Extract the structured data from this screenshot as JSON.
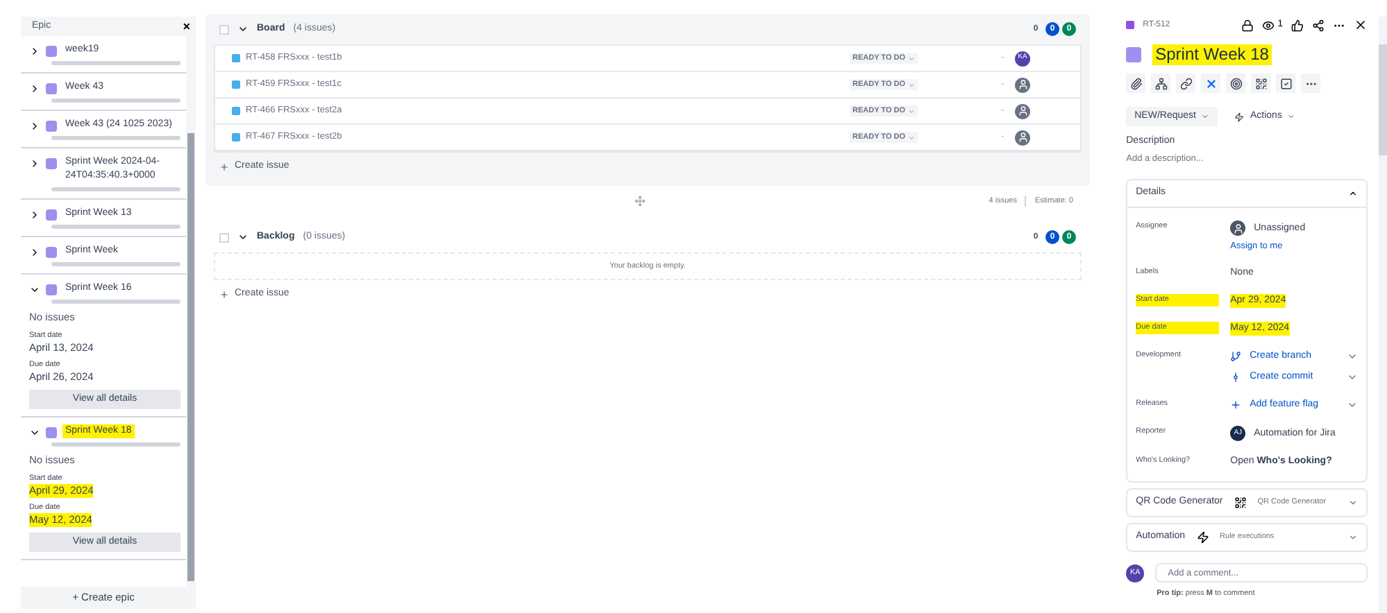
{
  "epic_panel": {
    "title": "Epic",
    "close": "×",
    "epics": [
      {
        "name": "week19",
        "expanded": false,
        "highlighted": false,
        "level": 0
      },
      {
        "name": "Week 43",
        "expanded": false,
        "highlighted": false,
        "level": 0
      },
      {
        "name": "Week 43 (24 1025 2023)",
        "expanded": false,
        "highlighted": false,
        "level": 0
      },
      {
        "name": "Sprint Week 2024-04-24T04:35:40.3+0000",
        "expanded": false,
        "highlighted": false,
        "level": 0
      },
      {
        "name": "Sprint Week 13",
        "expanded": false,
        "highlighted": false,
        "level": 0
      },
      {
        "name": "Sprint Week",
        "expanded": false,
        "highlighted": false,
        "level": 0
      },
      {
        "name": "Sprint Week 16",
        "expanded": true,
        "highlighted": false,
        "level": 0,
        "summary": "No issues",
        "start_label": "Start date",
        "start_date": "April 13, 2024",
        "start_highlighted": false,
        "due_label": "Due date",
        "due_date": "April 26, 2024",
        "due_highlighted": false,
        "button": "View all details"
      },
      {
        "name": "Sprint Week 18",
        "expanded": true,
        "highlighted": true,
        "level": 0,
        "summary": "No issues",
        "start_label": "Start date",
        "start_date": "April 29, 2024",
        "start_highlighted": true,
        "due_label": "Due date",
        "due_date": "May 12, 2024",
        "due_highlighted": true,
        "button": "View all details"
      }
    ],
    "create_button": "+ Create epic"
  },
  "sprints": [
    {
      "name": "Board",
      "checked": false,
      "count": "(4 issues)",
      "counters": [
        "0",
        "0",
        "0"
      ],
      "issues": [
        {
          "key": "RT-458",
          "summary": "FRSxxx - test1b",
          "status": "READY TO DO",
          "estimate": "-",
          "assignee": {
            "kind": "avatar",
            "initials": "KA"
          }
        },
        {
          "key": "RT-459",
          "summary": "FRSxxx - test1c",
          "status": "READY TO DO",
          "estimate": "-",
          "assignee": {
            "kind": "unassigned"
          }
        },
        {
          "key": "RT-466",
          "summary": "FRSxxx - test2a",
          "status": "READY TO DO",
          "estimate": "-",
          "assignee": {
            "kind": "unassigned"
          }
        },
        {
          "key": "RT-467",
          "summary": "FRSxxx - test2b",
          "status": "READY TO DO",
          "estimate": "-",
          "assignee": {
            "kind": "unassigned"
          }
        }
      ],
      "create": "Create issue",
      "footer": {
        "issues": "4 issues",
        "estimate": "Estimate: 0"
      }
    },
    {
      "name": "Backlog",
      "checked": false,
      "count": "(0 issues)",
      "counters": [
        "0",
        "0",
        "0"
      ],
      "empty": "Your backlog is empty.",
      "create": "Create issue"
    }
  ],
  "detail": {
    "key": "RT-512",
    "watchers": "1",
    "title": "Sprint Week 18",
    "title_highlighted": true,
    "status": "NEW/Request",
    "actions": "Actions",
    "description_label": "Description",
    "description_placeholder": "Add a description...",
    "details": {
      "title": "Details",
      "expanded": true,
      "fields": [
        {
          "label": "Assignee",
          "kind": "user",
          "value": "Unassigned",
          "link": "Assign to me",
          "highlighted": false
        },
        {
          "label": "Labels",
          "kind": "text",
          "value": "None",
          "highlighted": false
        },
        {
          "label": "Start date",
          "kind": "text",
          "value": "Apr 29, 2024",
          "highlighted": true
        },
        {
          "label": "Due date",
          "kind": "text",
          "value": "May 12, 2024",
          "highlighted": true
        },
        {
          "label": "Development",
          "kind": "links",
          "items": [
            "Create branch",
            "Create commit"
          ],
          "highlighted": false
        },
        {
          "label": "Releases",
          "kind": "links",
          "items": [
            "Add feature flag"
          ],
          "highlighted": false
        },
        {
          "label": "Reporter",
          "kind": "user",
          "initials": "AJ",
          "value": "Automation for Jira",
          "highlighted": false
        },
        {
          "label": "Who's Looking?",
          "kind": "rich",
          "value": "Open **Who's Looking?**",
          "highlighted": false
        }
      ]
    },
    "panels": [
      {
        "title": "QR Code Generator",
        "kind": "qr",
        "value": "QR Code Generator"
      },
      {
        "title": "Automation",
        "kind": "automation",
        "value": "Rule executions"
      }
    ],
    "comment": {
      "initials": "KA",
      "placeholder": "Add a comment...",
      "tip": "**Pro tip:** press **M** to comment"
    }
  }
}
